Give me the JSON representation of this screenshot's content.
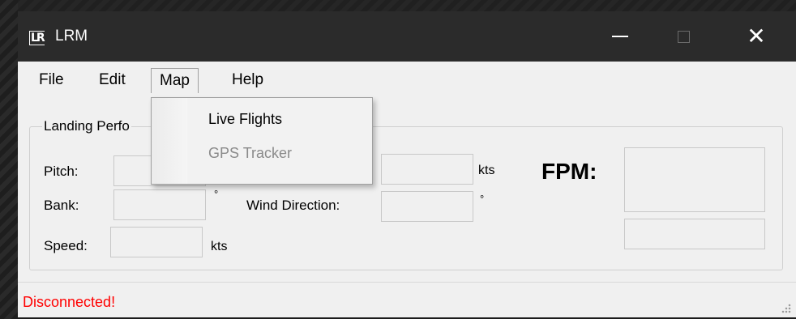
{
  "window": {
    "app_icon_text": "LR",
    "title": "LRM",
    "controls": {
      "minimize": "—",
      "maximize": "☐",
      "close": "✕"
    }
  },
  "menubar": {
    "items": [
      {
        "label": "File"
      },
      {
        "label": "Edit"
      },
      {
        "label": "Map"
      },
      {
        "label": "Help"
      }
    ]
  },
  "map_menu": {
    "items": [
      {
        "label": "Live Flights",
        "enabled": true
      },
      {
        "label": "GPS Tracker",
        "enabled": false
      }
    ]
  },
  "group": {
    "title_visible": "Landing Perfo"
  },
  "fields": {
    "pitch_label": "Pitch:",
    "bank_label": "Bank:",
    "bank_unit": "°",
    "speed_label": "Speed:",
    "speed_unit": "kts",
    "wind_speed_unit": "kts",
    "wind_direction_label": "Wind Direction:",
    "wind_direction_unit": "°",
    "fpm_label": "FPM:"
  },
  "status": {
    "text": "Disconnected!",
    "color": "#ff0000"
  }
}
